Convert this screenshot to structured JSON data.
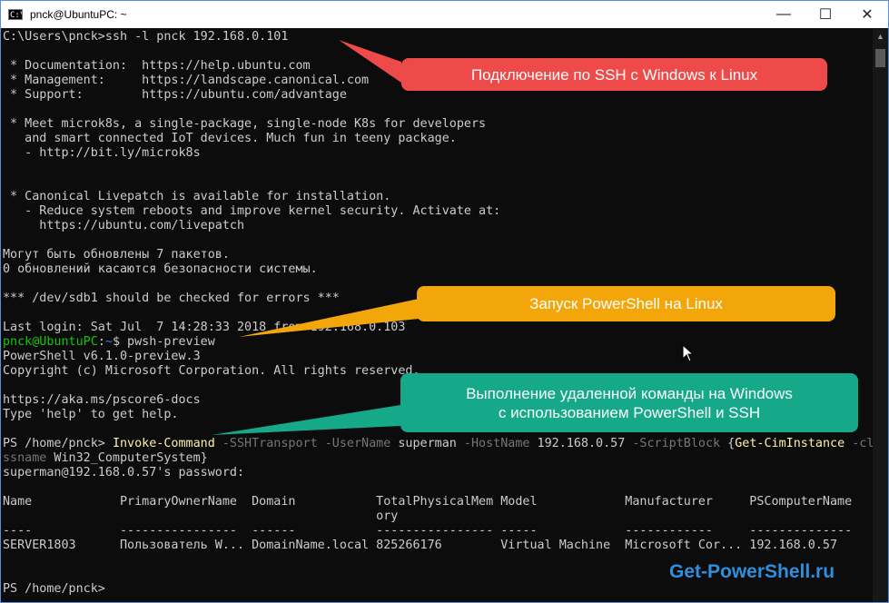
{
  "window": {
    "title": "pnck@UbuntuPC: ~",
    "icon_text": "C:\\_",
    "minimize_glyph": "—",
    "maximize_glyph": "☐",
    "close_glyph": "✕"
  },
  "terminal": {
    "lines": [
      "C:\\Users\\pnck>ssh -l pnck 192.168.0.101",
      "",
      " * Documentation:  https://help.ubuntu.com",
      " * Management:     https://landscape.canonical.com",
      " * Support:        https://ubuntu.com/advantage",
      "",
      " * Meet microk8s, a single-package, single-node K8s for developers",
      "   and smart connected IoT devices. Much fun in teeny package.",
      "   - http://bit.ly/microk8s",
      "",
      "",
      " * Canonical Livepatch is available for installation.",
      "   - Reduce system reboots and improve kernel security. Activate at:",
      "     https://ubuntu.com/livepatch",
      "",
      "Могут быть обновлены 7 пакетов.",
      "0 обновлений касаются безопасности системы.",
      "",
      "*** /dev/sdb1 should be checked for errors ***",
      "",
      "Last login: Sat Jul  7 14:28:33 2018 from 192.168.0.103"
    ],
    "prompt_user": "pnck@UbuntuPC",
    "prompt_sep": ":",
    "prompt_path": "~",
    "prompt_cmd": "$ pwsh-preview",
    "ps_lines": [
      "PowerShell v6.1.0-preview.3",
      "Copyright (c) Microsoft Corporation. All rights reserved.",
      "",
      "https://aka.ms/pscore6-docs",
      "Type 'help' to get help."
    ],
    "invoke": {
      "prompt": "PS /home/pnck> ",
      "cmdlet": "Invoke-Command",
      "p1": " -SSHTransport -UserName ",
      "v1": "superman",
      "p2": " -HostName ",
      "v2": "192.168.0.57",
      "p3": " -ScriptBlock ",
      "v3": "{",
      "cmdlet2": "Get-CimInstance",
      "p4": " -cla",
      "p4b": "ssname",
      "v4": " Win32_ComputerSystem}"
    },
    "password_line": "superman@192.168.0.57's password:",
    "table": {
      "header1": "Name            PrimaryOwnerName  Domain           TotalPhysicalMem Model            Manufacturer     PSComputerName",
      "header2": "                                                   ory",
      "separator": "----            ----------------  ------           ---------------- -----            ------------     --------------",
      "row": "SERVER1803      Пользователь W... DomainName.local 825266176        Virtual Machine  Microsoft Cor... 192.168.0.57"
    },
    "final_prompt": "PS /home/pnck>"
  },
  "callouts": {
    "ssh": "Подключение по SSH с Windows к Linux",
    "pwsh": "Запуск PowerShell на Linux",
    "remote_line1": "Выполнение удаленной команды на Windows",
    "remote_line2": "с использованием PowerShell и SSH"
  },
  "watermark": "Get-PowerShell.ru",
  "colors": {
    "callout_red": "#ef4a4a",
    "callout_orange": "#f2a60a",
    "callout_teal": "#15a889",
    "watermark": "#2f8fde",
    "prompt_green": "#16c60c",
    "ps_yellow": "#f9f1a5",
    "ps_gray": "#767676"
  },
  "icons": [
    "console-app-icon",
    "minimize-icon",
    "maximize-icon",
    "close-icon",
    "scroll-up-icon",
    "mouse-pointer-icon"
  ]
}
